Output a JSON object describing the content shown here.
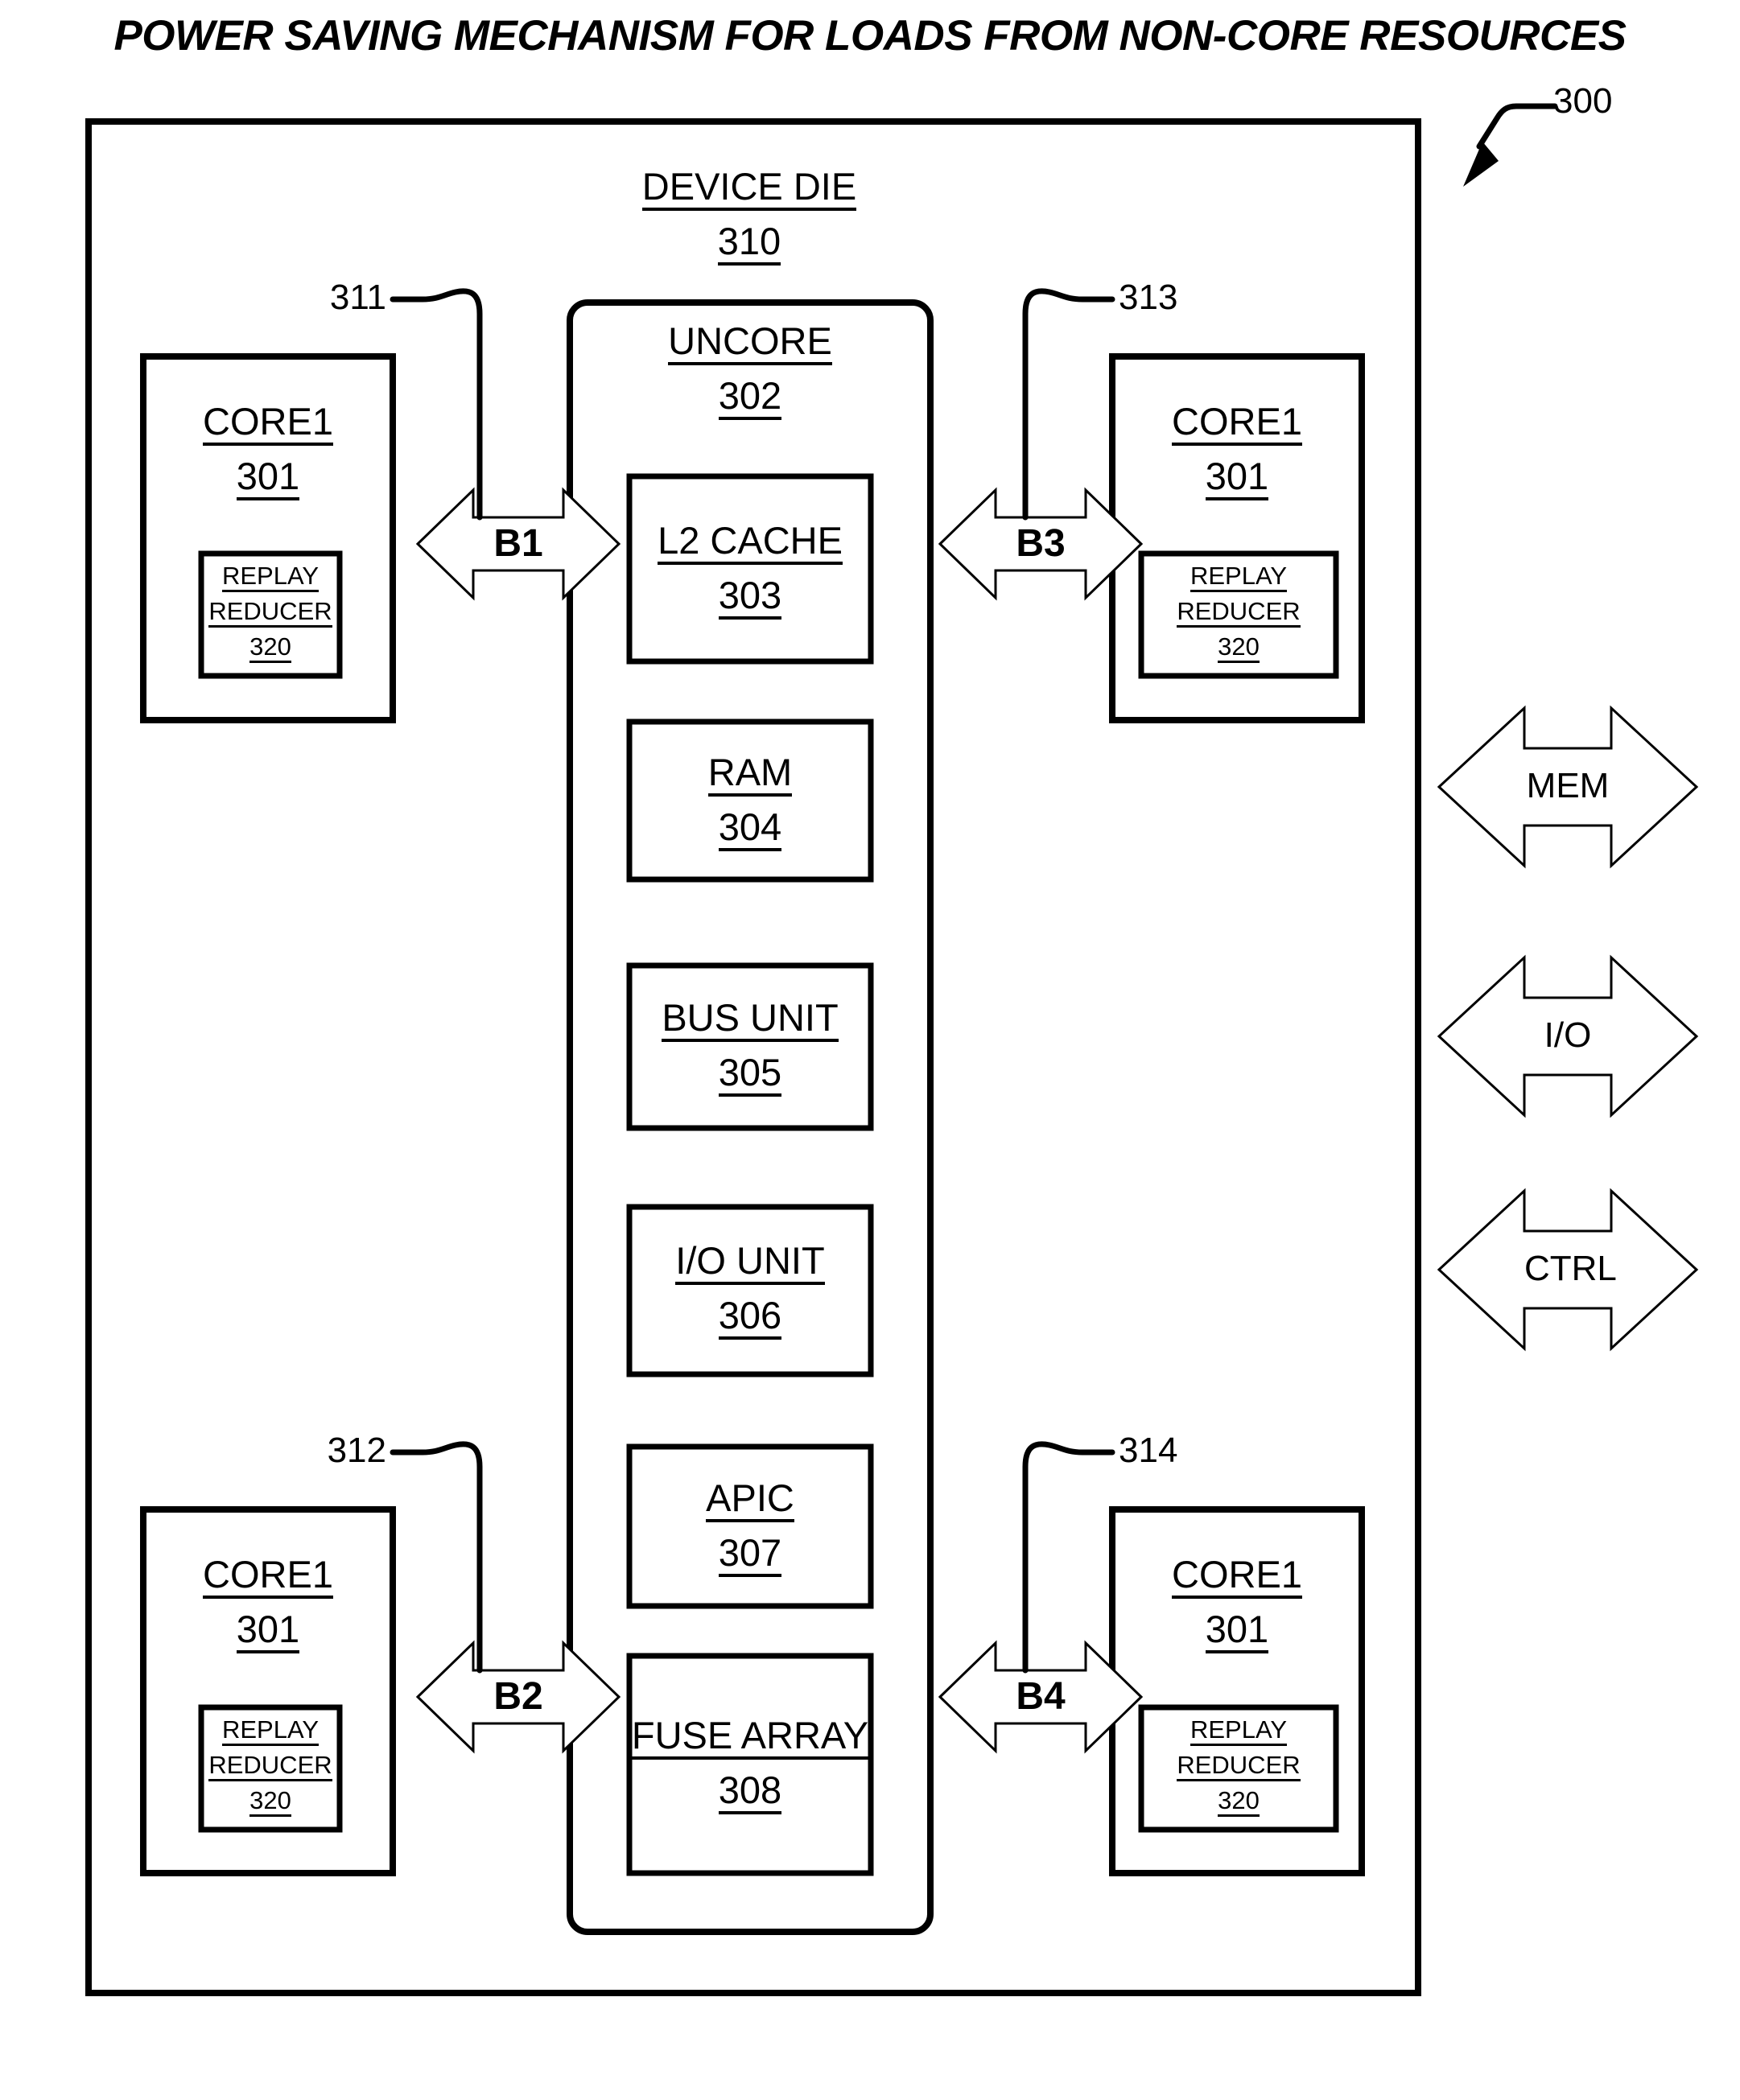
{
  "figure": {
    "title": "POWER SAVING MECHANISM FOR LOADS FROM NON-CORE RESOURCES",
    "figure_ref": "300"
  },
  "device_die": {
    "label": "DEVICE DIE",
    "ref": "310"
  },
  "uncore": {
    "label": "UNCORE",
    "ref": "302",
    "blocks": [
      {
        "label": "L2 CACHE",
        "ref": "303"
      },
      {
        "label": "RAM",
        "ref": "304"
      },
      {
        "label": "BUS UNIT",
        "ref": "305"
      },
      {
        "label": "I/O UNIT",
        "ref": "306"
      },
      {
        "label": "APIC",
        "ref": "307"
      },
      {
        "label": "FUSE ARRAY",
        "ref": "308"
      }
    ]
  },
  "cores": [
    {
      "position": "top-left",
      "label": "CORE1",
      "ref": "301",
      "inner": {
        "line1": "REPLAY",
        "line2": "REDUCER",
        "ref": "320"
      }
    },
    {
      "position": "top-right",
      "label": "CORE1",
      "ref": "301",
      "inner": {
        "line1": "REPLAY",
        "line2": "REDUCER",
        "ref": "320"
      }
    },
    {
      "position": "bottom-left",
      "label": "CORE1",
      "ref": "301",
      "inner": {
        "line1": "REPLAY",
        "line2": "REDUCER",
        "ref": "320"
      }
    },
    {
      "position": "bottom-right",
      "label": "CORE1",
      "ref": "301",
      "inner": {
        "line1": "REPLAY",
        "line2": "REDUCER",
        "ref": "320"
      }
    }
  ],
  "buses": [
    {
      "label": "B1",
      "ref": "311",
      "position": "top-left"
    },
    {
      "label": "B2",
      "ref": "312",
      "position": "bottom-left"
    },
    {
      "label": "B3",
      "ref": "313",
      "position": "top-right"
    },
    {
      "label": "B4",
      "ref": "314",
      "position": "bottom-right"
    }
  ],
  "external_interfaces": [
    {
      "label": "MEM"
    },
    {
      "label": "I/O"
    },
    {
      "label": "CTRL"
    }
  ],
  "colors": {
    "line": "#000000",
    "text": "#000000",
    "background": "#ffffff"
  }
}
